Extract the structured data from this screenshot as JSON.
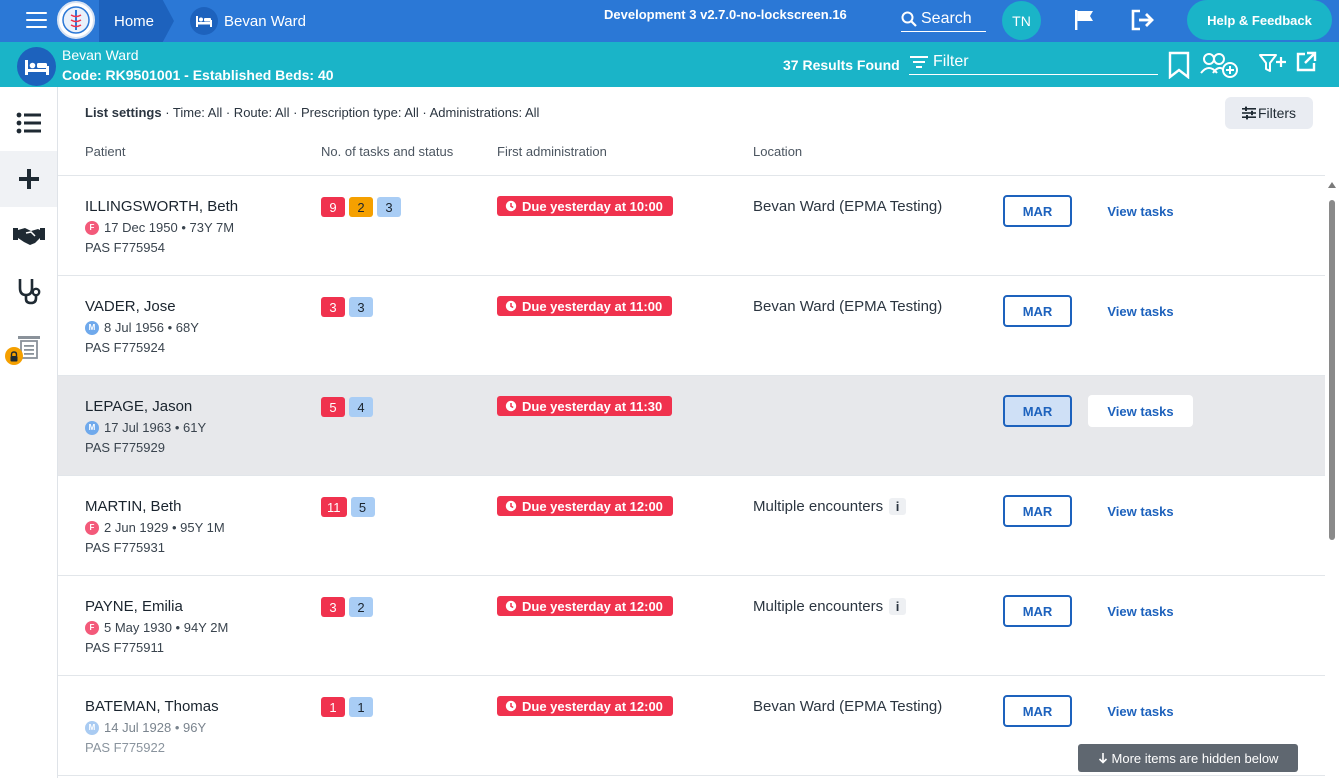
{
  "topbar": {
    "home_label": "Home",
    "ward_label": "Bevan Ward",
    "environment": "Development 3 v2.7.0-no-lockscreen.16",
    "search_label": "Search",
    "user_initials": "TN",
    "help_label": "Help & Feedback"
  },
  "subbar": {
    "ward_name": "Bevan Ward",
    "ward_code_line": "Code: RK9501001 - Established Beds: 40",
    "results_found": "37 Results Found",
    "filter_placeholder": "Filter"
  },
  "list": {
    "settings_label": "List settings",
    "settings_rest": " · Time: All · Route: All · Prescription type: All · Administrations: All",
    "filters_label": "Filters",
    "columns": {
      "patient": "Patient",
      "tasks": "No. of tasks and status",
      "first_admin": "First administration",
      "location": "Location"
    },
    "mar_label": "MAR",
    "view_tasks_label": "View tasks",
    "more_hidden": "More items are hidden below",
    "rows": [
      {
        "name": "ILLINGSWORTH, Beth",
        "gender": "F",
        "dob_age": "17 Dec 1950 • 73Y 7M",
        "pas": "PAS F775954",
        "badges": [
          {
            "value": "9",
            "color": "red"
          },
          {
            "value": "2",
            "color": "orange"
          },
          {
            "value": "3",
            "color": "blue"
          }
        ],
        "due": "Due yesterday at 10:00",
        "location": "Bevan Ward (EPMA Testing)",
        "location_info": false
      },
      {
        "name": "VADER, Jose",
        "gender": "M",
        "dob_age": "8 Jul 1956 • 68Y",
        "pas": "PAS F775924",
        "badges": [
          {
            "value": "3",
            "color": "red"
          },
          {
            "value": "3",
            "color": "blue"
          }
        ],
        "due": "Due yesterday at 11:00",
        "location": "Bevan Ward (EPMA Testing)",
        "location_info": false
      },
      {
        "name": "LEPAGE, Jason",
        "gender": "M",
        "dob_age": "17 Jul 1963 • 61Y",
        "pas": "PAS F775929",
        "badges": [
          {
            "value": "5",
            "color": "red"
          },
          {
            "value": "4",
            "color": "blue"
          }
        ],
        "due": "Due yesterday at 11:30",
        "location": "",
        "location_info": false,
        "highlighted": true
      },
      {
        "name": "MARTIN, Beth",
        "gender": "F",
        "dob_age": "2 Jun 1929 • 95Y 1M",
        "pas": "PAS F775931",
        "badges": [
          {
            "value": "11",
            "color": "red"
          },
          {
            "value": "5",
            "color": "blue"
          }
        ],
        "due": "Due yesterday at 12:00",
        "location": "Multiple encounters",
        "location_info": true
      },
      {
        "name": "PAYNE, Emilia",
        "gender": "F",
        "dob_age": "5 May 1930 • 94Y 2M",
        "pas": "PAS F775911",
        "badges": [
          {
            "value": "3",
            "color": "red"
          },
          {
            "value": "2",
            "color": "blue"
          }
        ],
        "due": "Due yesterday at 12:00",
        "location": "Multiple encounters",
        "location_info": true
      },
      {
        "name": "BATEMAN, Thomas",
        "gender": "M",
        "dob_age": "14 Jul 1928 • 96Y",
        "pas": "PAS F775922",
        "badges": [
          {
            "value": "1",
            "color": "red"
          },
          {
            "value": "1",
            "color": "blue"
          }
        ],
        "due": "Due yesterday at 12:00",
        "location": "Bevan Ward (EPMA Testing)",
        "location_info": false,
        "faded": true
      }
    ]
  },
  "colors": {
    "primary": "#2b78d6",
    "teal": "#1ab4c8",
    "alert_red": "#f0324e",
    "amber": "#f5a000",
    "info_blue": "#a9cdf5"
  },
  "icons": [
    "menu-icon",
    "logo-icon",
    "bed-icon",
    "search-icon",
    "flag-icon",
    "logout-icon",
    "bookmark-icon",
    "add-users-icon",
    "filter-add-icon",
    "open-external-icon",
    "list-icon",
    "plus-icon",
    "handshake-icon",
    "stethoscope-icon",
    "locked-report-icon",
    "clock-icon",
    "info-icon",
    "arrow-down-icon",
    "sliders-icon"
  ]
}
